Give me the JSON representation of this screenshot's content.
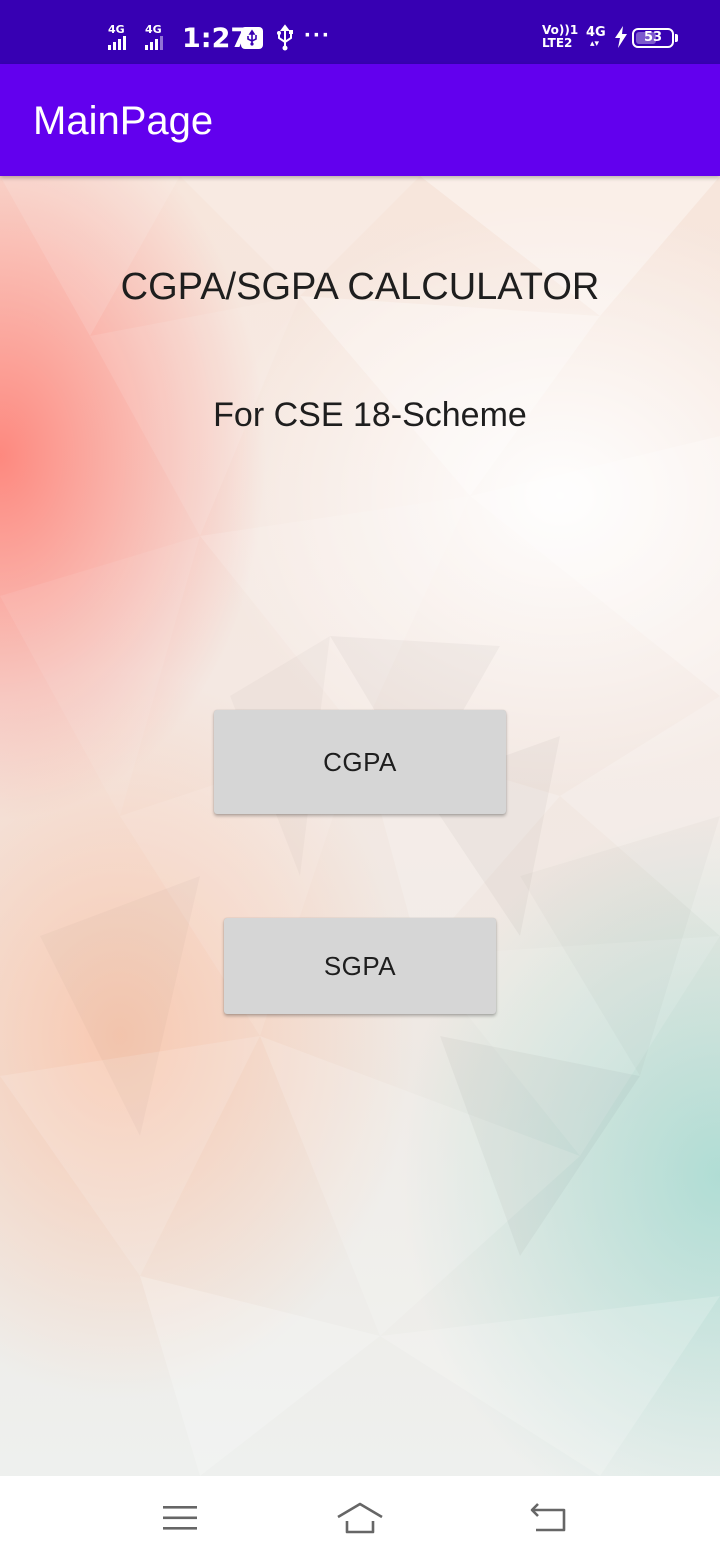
{
  "status_bar": {
    "sim1_network": "4G",
    "sim2_network": "4G",
    "time": "1:27",
    "volte_label_top": "Vo))1",
    "volte_label_bottom": "LTE2",
    "data_network": "4G",
    "battery_level": "53",
    "icons": [
      "signal-icon",
      "signal-icon",
      "usb-settings-icon",
      "usb-icon",
      "more-dots-icon",
      "volte-icon",
      "mobile-data-icon",
      "charging-icon",
      "battery-icon"
    ]
  },
  "app_bar": {
    "title": "MainPage",
    "color": "#6200ee"
  },
  "main": {
    "heading": "CGPA/SGPA CALCULATOR",
    "subheading": "For CSE 18-Scheme",
    "buttons": {
      "cgpa": "CGPA",
      "sgpa": "SGPA"
    }
  },
  "nav_bar": {
    "icons": [
      "menu-icon",
      "home-icon",
      "back-icon"
    ]
  },
  "colors": {
    "status_bar": "#3700b3",
    "app_bar": "#6200ee",
    "button": "#d6d6d6",
    "text": "#1e1e1e"
  }
}
